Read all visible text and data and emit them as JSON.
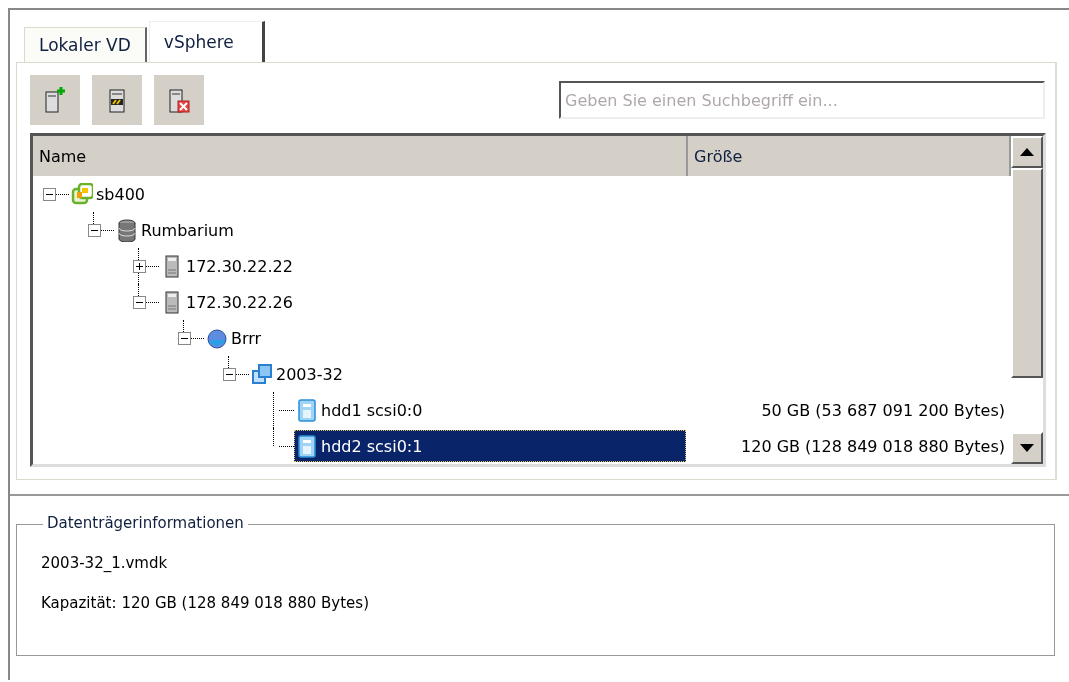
{
  "tabs": [
    {
      "label": "Lokaler VD",
      "selected": false
    },
    {
      "label": "vSphere",
      "selected": true
    }
  ],
  "toolbar": [
    {
      "kind": "add"
    },
    {
      "kind": "edit"
    },
    {
      "kind": "remove"
    }
  ],
  "search": {
    "placeholder": "Geben Sie einen Suchbegriff ein..."
  },
  "table": {
    "columns": [
      "Name",
      "Größe"
    ],
    "tree": [
      {
        "name": "sb400",
        "kind": "vcenter",
        "expanded": true,
        "selected": false,
        "children": [
          {
            "name": "Rumbarium",
            "kind": "datacenter",
            "expanded": true,
            "selected": false,
            "children": [
              {
                "name": "172.30.22.22",
                "kind": "host",
                "expanded": false,
                "selected": false
              },
              {
                "name": "172.30.22.26",
                "kind": "host",
                "expanded": true,
                "selected": false,
                "children": [
                  {
                    "name": "Brrr",
                    "kind": "pool",
                    "expanded": true,
                    "selected": false,
                    "children": [
                      {
                        "name": "2003-32",
                        "kind": "vm",
                        "expanded": true,
                        "selected": false,
                        "children": [
                          {
                            "name": "hdd1 scsi0:0",
                            "kind": "disk",
                            "size": "50 GB (53 687 091 200 Bytes)",
                            "selected": false
                          },
                          {
                            "name": "hdd2 scsi0:1",
                            "kind": "disk",
                            "size": "120 GB (128 849 018 880 Bytes)",
                            "selected": true
                          }
                        ]
                      }
                    ]
                  }
                ]
              }
            ]
          }
        ]
      }
    ]
  },
  "info": {
    "title": "Datenträgerinformationen",
    "file": "2003-32_1.vmdk",
    "capacity_label": "Kapazität:",
    "capacity": "120 GB (128 849 018 880 Bytes)"
  }
}
